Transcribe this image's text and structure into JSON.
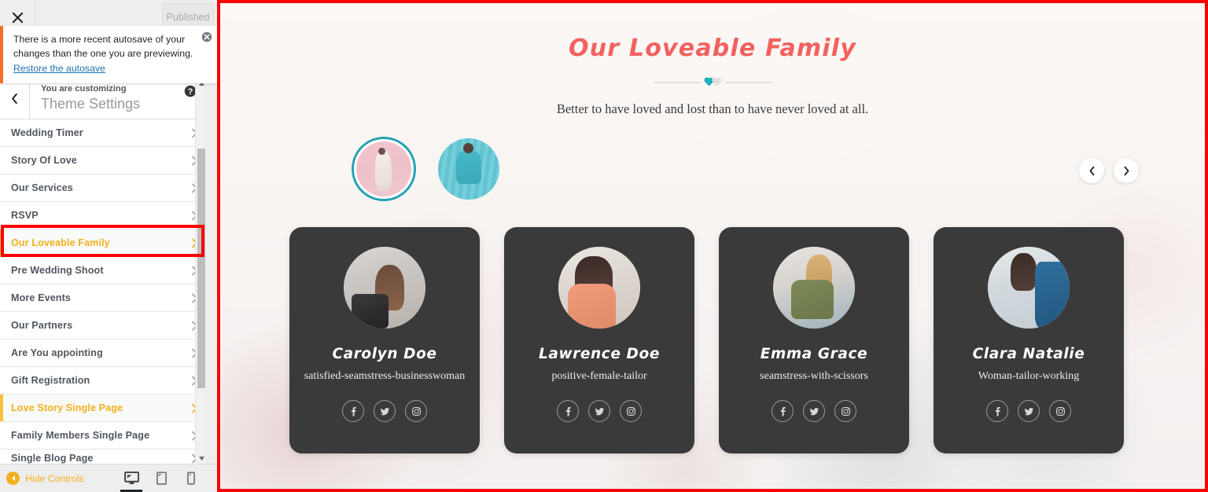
{
  "customizer": {
    "close_label": "Close",
    "publish_label": "Published",
    "notice": {
      "text": "There is a more recent autosave of your changes than the one you are previewing.",
      "link_label": "Restore the autosave",
      "dismiss_label": "Dismiss"
    },
    "panel": {
      "eyebrow": "You are customizing",
      "title": "Theme Settings",
      "back_label": "Back",
      "help_label": "Help"
    },
    "menu_items": [
      {
        "label": "Wedding Timer",
        "active": false
      },
      {
        "label": "Story Of Love",
        "active": false
      },
      {
        "label": "Our Services",
        "active": false
      },
      {
        "label": "RSVP",
        "active": false
      },
      {
        "label": "Our Loveable Family",
        "active": true
      },
      {
        "label": "Pre Wedding Shoot",
        "active": false
      },
      {
        "label": "More Events",
        "active": false
      },
      {
        "label": "Our Partners",
        "active": false
      },
      {
        "label": "Are You appointing",
        "active": false
      },
      {
        "label": "Gift Registration",
        "active": false
      },
      {
        "label": "Love Story Single Page",
        "active": true
      },
      {
        "label": "Family Members Single Page",
        "active": false
      },
      {
        "label": "Single Blog Page",
        "active": false
      }
    ],
    "footer": {
      "hide_controls_label": "Hide Controls",
      "devices": [
        {
          "name": "desktop",
          "selected": true
        },
        {
          "name": "tablet",
          "selected": false
        },
        {
          "name": "mobile",
          "selected": false
        }
      ]
    },
    "accent_color": "#f2b11e",
    "annotation_color": "#fc0000"
  },
  "preview": {
    "title": "Our Loveable Family",
    "subtitle": "Better to have loved and lost than to have never loved at all.",
    "title_color": "#f2615f",
    "heart_active_color": "#1eafbb",
    "heart_inactive_color": "#e2e0de",
    "thumbnails": [
      {
        "alt": "woman-in-pink-dress",
        "active": true
      },
      {
        "alt": "woman-in-teal-blouse",
        "active": false
      }
    ],
    "carousel": {
      "prev_label": "Previous",
      "next_label": "Next"
    },
    "members": [
      {
        "name": "Carolyn Doe",
        "role": "satisfied-seamstress-businesswoman",
        "socials": [
          "facebook",
          "twitter",
          "instagram"
        ]
      },
      {
        "name": "Lawrence Doe",
        "role": "positive-female-tailor",
        "socials": [
          "facebook",
          "twitter",
          "instagram"
        ]
      },
      {
        "name": "Emma Grace",
        "role": "seamstress-with-scissors",
        "socials": [
          "facebook",
          "twitter",
          "instagram"
        ]
      },
      {
        "name": "Clara Natalie",
        "role": "Woman-tailor-working",
        "socials": [
          "facebook",
          "twitter",
          "instagram"
        ]
      }
    ]
  }
}
